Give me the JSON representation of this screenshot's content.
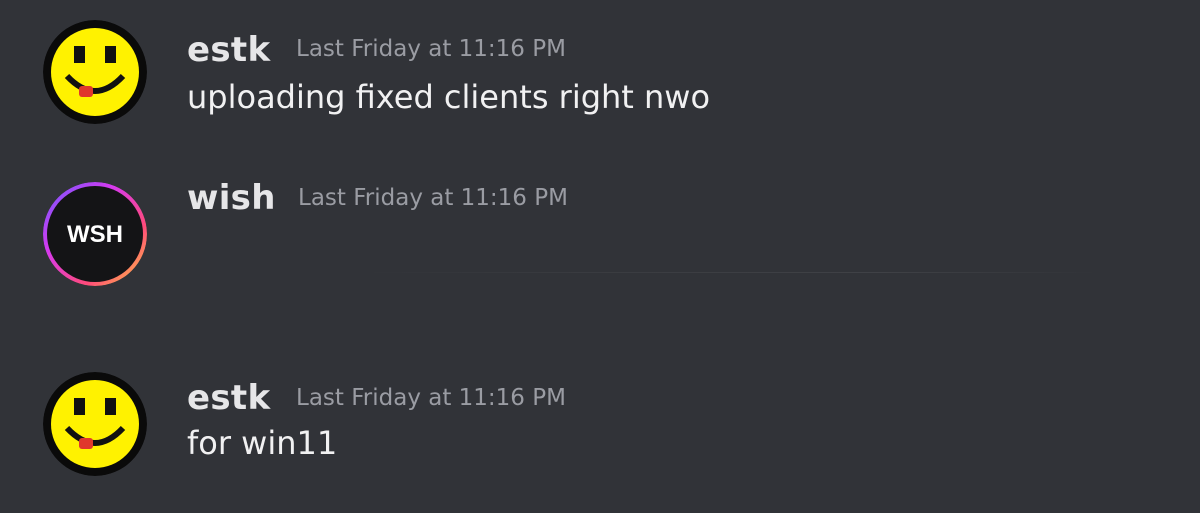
{
  "colors": {
    "background": "#313338",
    "username": "#e6e6e8",
    "timestamp": "#9a9ca3",
    "content": "#f1f1f2",
    "smiley_yellow": "#fff200"
  },
  "messages": [
    {
      "author": "estk",
      "avatar_icon": "smiley-face-avatar",
      "timestamp": "Last Friday at 11:16 PM",
      "content": "uploading fixed clients right nwo"
    },
    {
      "author": "wish",
      "avatar_icon": "wsh-ring-avatar",
      "avatar_text": "WSH",
      "timestamp": "Last Friday at 11:16 PM",
      "content": ""
    },
    {
      "author": "estk",
      "avatar_icon": "smiley-face-avatar",
      "timestamp": "Last Friday at 11:16 PM",
      "content": "for win11"
    }
  ]
}
